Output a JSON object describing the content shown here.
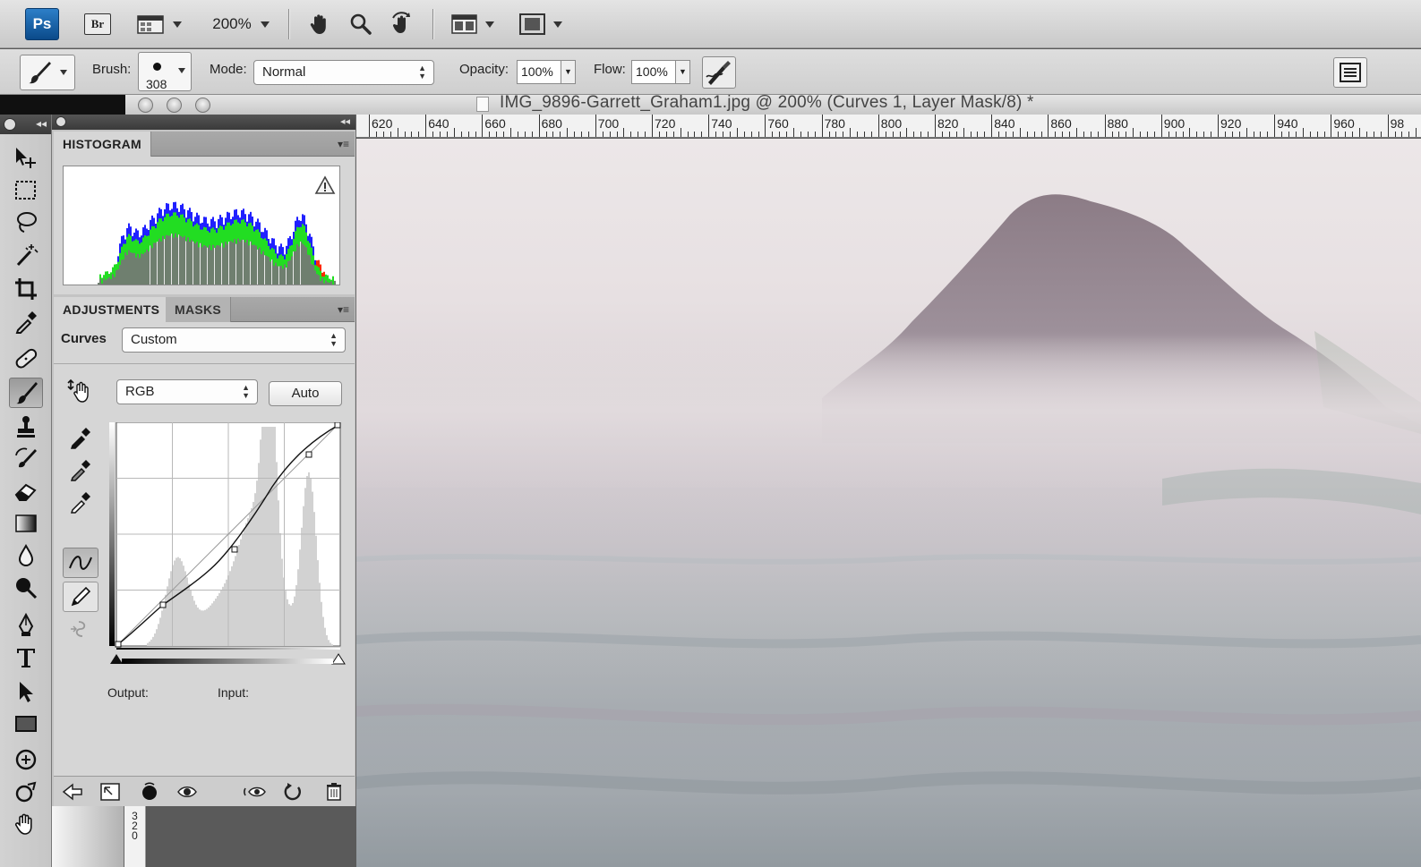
{
  "app": {
    "logo": "Ps",
    "bridge": "Br",
    "zoom": "200%"
  },
  "options": {
    "brush_label": "Brush:",
    "brush_size": "308",
    "mode_label": "Mode:",
    "mode_value": "Normal",
    "opacity_label": "Opacity:",
    "opacity_value": "100%",
    "flow_label": "Flow:",
    "flow_value": "100%"
  },
  "document": {
    "title": "IMG_9896-Garrett_Graham1.jpg @ 200% (Curves 1, Layer Mask/8) *"
  },
  "ruler": {
    "labels": [
      "620",
      "640",
      "660",
      "680",
      "700",
      "720",
      "740",
      "760",
      "780",
      "800",
      "820",
      "840",
      "860",
      "880",
      "900",
      "920",
      "940",
      "960",
      "98"
    ]
  },
  "histogram_panel": {
    "tab": "HISTOGRAM"
  },
  "adjustments_panel": {
    "tab_adjustments": "ADJUSTMENTS",
    "tab_masks": "MASKS",
    "curves_label": "Curves",
    "preset": "Custom",
    "channel": "RGB",
    "auto_label": "Auto",
    "output_label": "Output:",
    "input_label": "Input:"
  },
  "vruler": {
    "digits": [
      "3",
      "2",
      "0"
    ]
  },
  "colors": {
    "ps_blue": "#1f66ad",
    "panel_bg": "#d6d6d6",
    "toolbar_bg": "#c9c9c9"
  }
}
